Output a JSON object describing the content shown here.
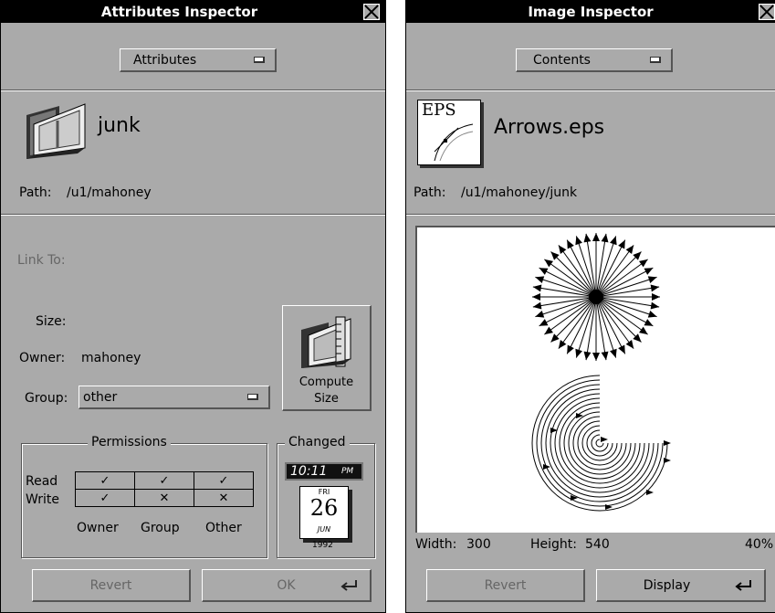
{
  "attributes": {
    "title": "Attributes Inspector",
    "mode": "Attributes",
    "name": "junk",
    "path_label": "Path:",
    "path": "/u1/mahoney",
    "link_label": "Link To:",
    "size_label": "Size:",
    "owner_label": "Owner:",
    "owner": "mahoney",
    "group_label": "Group:",
    "group": "other",
    "compute_line1": "Compute",
    "compute_line2": "Size",
    "permissions": {
      "title": "Permissions",
      "read_label": "Read",
      "write_label": "Write",
      "read": [
        "✓",
        "✓",
        "✓"
      ],
      "write": [
        "✓",
        "✕",
        "✕"
      ],
      "columns": [
        "Owner",
        "Group",
        "Other"
      ]
    },
    "changed": {
      "title": "Changed",
      "time": "10:11",
      "ampm": "PM",
      "weekday": "FRI",
      "day": "26",
      "month": "JUN",
      "year": "1992"
    },
    "revert": "Revert",
    "ok": "OK"
  },
  "image": {
    "title": "Image Inspector",
    "mode": "Contents",
    "file_icon_text": "EPS",
    "name": "Arrows.eps",
    "path_label": "Path:",
    "path": "/u1/mahoney/junk",
    "width_label": "Width:",
    "width": "300",
    "height_label": "Height:",
    "height": "540",
    "zoom": "40%",
    "revert": "Revert",
    "display": "Display"
  },
  "colors": {
    "panel": "#aaaaaa",
    "shadow": "#555555",
    "dim_text": "#666666"
  }
}
